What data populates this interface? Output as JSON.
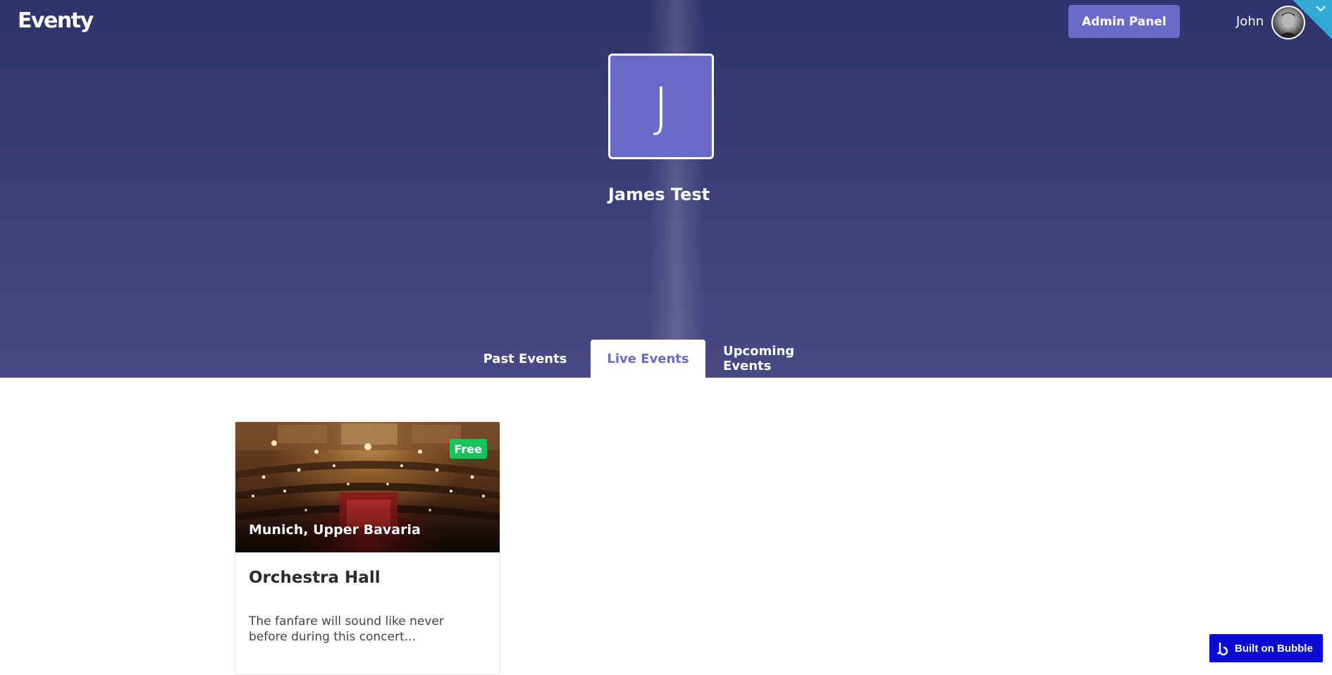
{
  "header": {
    "logo": "Eventy",
    "admin_button": "Admin Panel",
    "user_name": "John"
  },
  "profile": {
    "initial": "J",
    "name": "James Test"
  },
  "tabs": [
    {
      "label": "Past Events",
      "active": false
    },
    {
      "label": "Live Events",
      "active": true
    },
    {
      "label": "Upcoming Events",
      "active": false
    }
  ],
  "events": [
    {
      "price_badge": "Free",
      "location": "Munich, Upper Bavaria",
      "title": "Orchestra Hall",
      "description": "The fanfare will sound like never before during this concert..."
    }
  ],
  "footer": {
    "badge": "Built on Bubble"
  },
  "colors": {
    "accent": "#6a6acb",
    "hero_top": "#2f336b",
    "hero_bottom": "#4a4884",
    "free_badge": "#16c45a",
    "corner_tab": "#33a9d6",
    "bubble_badge": "#0a0ad0"
  }
}
